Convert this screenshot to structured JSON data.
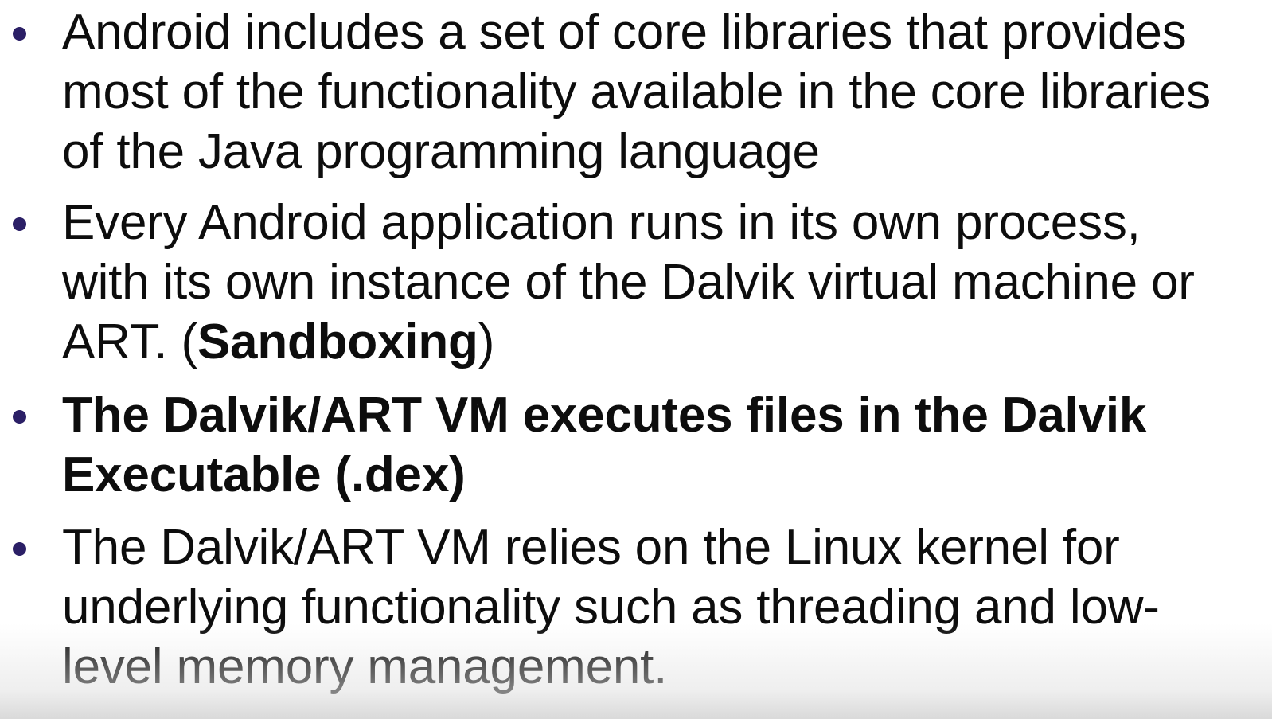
{
  "slide": {
    "bullets": [
      {
        "lines": [
          "Android includes a set of core libraries that provides",
          "most of the functionality available in the core libraries",
          "of the Java programming language"
        ]
      },
      {
        "lines": [
          "Every Android application runs in its own process,",
          "with its own instance of the Dalvik virtual machine or"
        ],
        "last_line_prefix": "ART. (",
        "last_line_bold": "Sandboxing",
        "last_line_suffix": ")"
      },
      {
        "bold": true,
        "lines": [
          "The Dalvik/ART VM executes files in the Dalvik",
          "Executable (.dex)"
        ]
      },
      {
        "lines": [
          "The Dalvik/ART VM relies on the Linux kernel for",
          "underlying functionality such as threading and low-",
          "level memory management."
        ]
      }
    ],
    "bullet_color": "#2b1f66",
    "text_color": "#0d0d0d"
  }
}
